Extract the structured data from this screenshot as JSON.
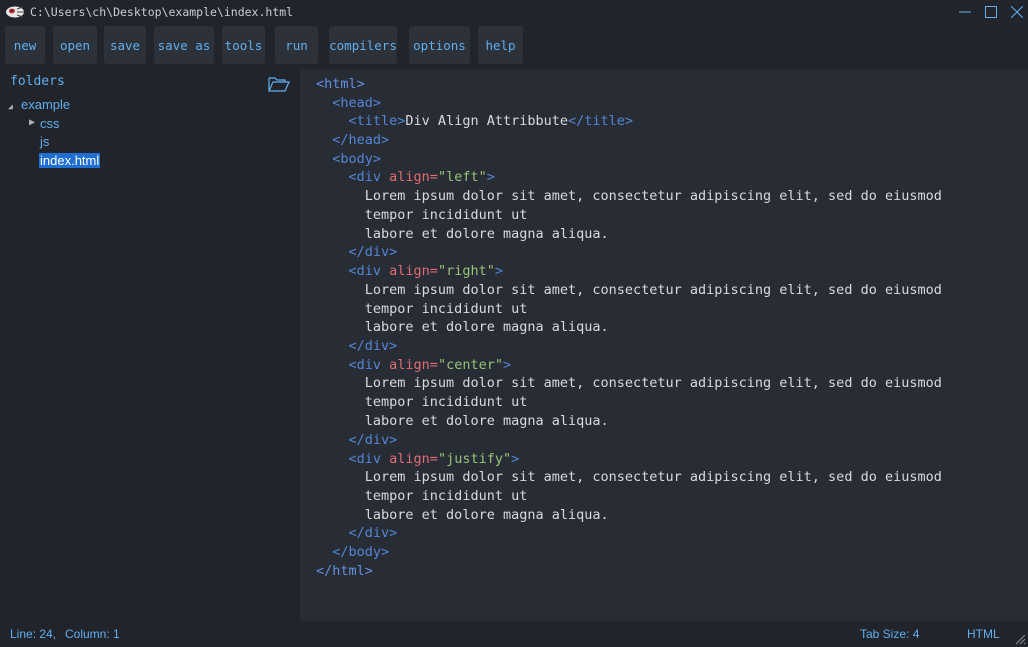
{
  "window": {
    "title": "C:\\Users\\ch\\Desktop\\example\\index.html",
    "logo_icon": "app-logo-icon",
    "controls": [
      "minimize-icon",
      "maximize-icon",
      "close-icon"
    ]
  },
  "menu": {
    "items": [
      {
        "label": "new"
      },
      {
        "label": "open"
      },
      {
        "label": "save"
      },
      {
        "label": "save as"
      },
      {
        "label": "tools"
      },
      {
        "label": "run"
      },
      {
        "label": "compilers"
      },
      {
        "label": "options"
      },
      {
        "label": "help"
      }
    ]
  },
  "sidebar": {
    "title": "folders",
    "open_folder_icon": "folder-open-icon",
    "tree": {
      "root": "example",
      "children": [
        {
          "label": "css",
          "collapsed": true
        },
        {
          "label": "js"
        },
        {
          "label": "index.html",
          "selected": true
        }
      ]
    }
  },
  "editor": {
    "language": "HTML",
    "title_text": "Div Align Attribbute",
    "lorem_1": "Lorem ipsum dolor sit amet, consectetur adipiscing elit, sed do eiusmod",
    "lorem_2": "tempor incididunt ut",
    "lorem_3": "labore et dolore magna aliqua.",
    "alignments": [
      "left",
      "right",
      "center",
      "justify"
    ]
  },
  "status": {
    "line": "Line: 24,",
    "column": "Column: 1",
    "tab_size": "Tab Size: 4",
    "language": "HTML"
  },
  "colors": {
    "background": "#1e222a",
    "panel": "#21252b",
    "editor": "#282c34",
    "accent": "#61afef",
    "tag": "#5386d6",
    "attribute": "#e06c75",
    "string": "#98c379",
    "text": "#d7dae0",
    "selection": "#1f6ed4"
  }
}
